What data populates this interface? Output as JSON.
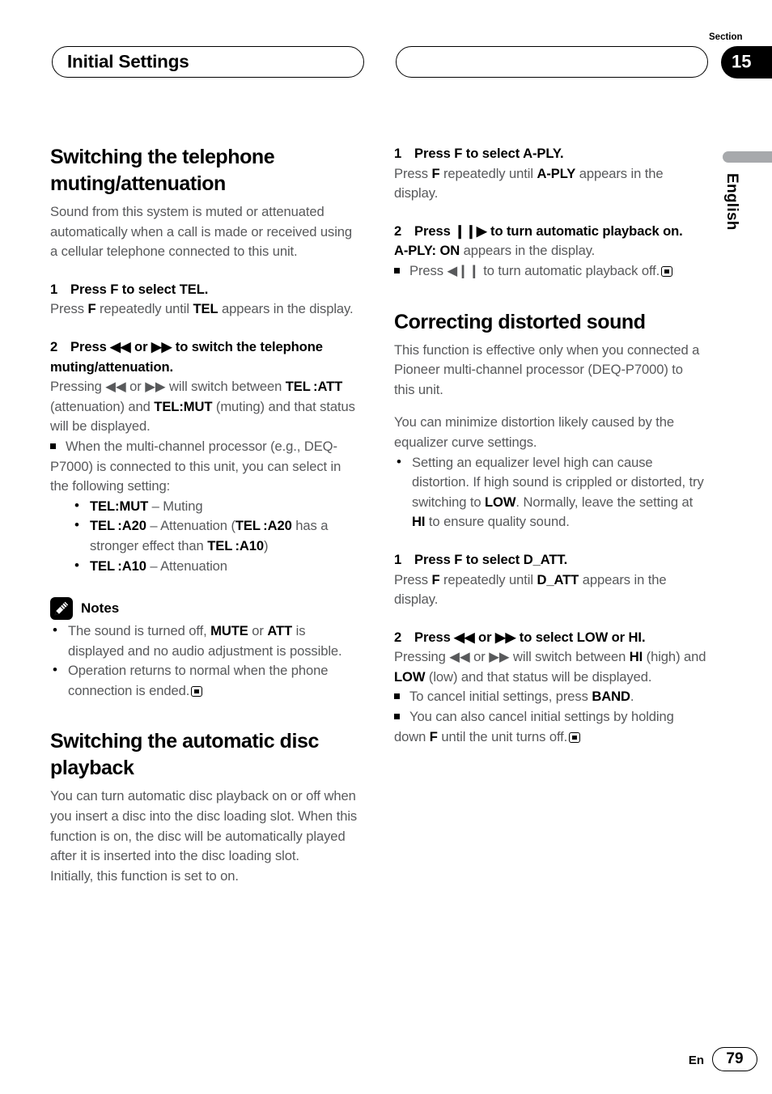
{
  "header": {
    "left_title": "Initial Settings",
    "right_title": "",
    "section_label": "Section",
    "section_number": "15"
  },
  "side_tab": {
    "language": "English"
  },
  "footer": {
    "lang_code": "En",
    "page_number": "79"
  },
  "icons": {
    "notes_icon": "pencil-icon",
    "end_of_section": "filled-square-in-box"
  },
  "colors": {
    "body_text": "#58595b",
    "heading_text": "#000000",
    "badge_bg": "#000000",
    "lang_bar": "#a7a9ac"
  },
  "left_column": {
    "heading1": "Switching the telephone muting/attenuation",
    "intro1": "Sound from this system is muted or attenuated automatically when a call is made or received using a cellular telephone connected to this unit.",
    "step1": {
      "number": "1",
      "title": "Press F to select TEL.",
      "body_pre": "Press ",
      "body_b1": "F",
      "body_mid": " repeatedly until ",
      "body_b2": "TEL",
      "body_post": " appears in the display."
    },
    "step2": {
      "number": "2",
      "title": "Press ◀◀ or ▶▶ to switch the telephone muting/attenuation.",
      "body_pre": "Pressing ",
      "body_sym1": "◀◀",
      "body_mid1": " or ",
      "body_sym2": "▶▶",
      "body_mid2": " will switch between ",
      "body_b1": "TEL :ATT",
      "body_mid3": " (attenuation) and ",
      "body_b2": "TEL:MUT",
      "body_post": " (muting) and that status will be displayed."
    },
    "note_square": "When the multi-channel processor (e.g., DEQ-P7000) is connected to this unit, you can select in the following setting:",
    "setting_bullets": [
      {
        "term": "TEL:MUT",
        "desc": " – Muting"
      },
      {
        "term": "TEL :A20",
        "desc_a": " – Attenuation (",
        "term2": "TEL :A20",
        "desc_b": " has a stronger effect than ",
        "term3": "TEL :A10",
        "desc_c": ")"
      },
      {
        "term": "TEL :A10",
        "desc": " – Attenuation"
      }
    ],
    "notes_title": "Notes",
    "notes": [
      {
        "pre": "The sound is turned off, ",
        "b1": "MUTE",
        "mid": " or ",
        "b2": "ATT",
        "post": " is displayed and no audio adjustment is possible."
      },
      {
        "pre": "Operation returns to normal when the phone connection is ended.",
        "b1": "",
        "mid": "",
        "b2": "",
        "post": ""
      }
    ],
    "heading2": "Switching the automatic disc playback",
    "intro2": "You can turn automatic disc playback on or off when you insert a disc into the disc loading slot. When this function is on, the disc will be automatically played after it is inserted into the disc loading slot.",
    "intro2b": "Initially, this function is set to on."
  },
  "right_column": {
    "step1": {
      "number": "1",
      "title": "Press F to select A-PLY.",
      "body_pre": "Press ",
      "body_b1": "F",
      "body_mid": " repeatedly until ",
      "body_b2": "A-PLY",
      "body_post": " appears in the display."
    },
    "step2": {
      "number": "2",
      "title_pre": "Press ",
      "title_sym": "❙❙▶",
      "title_post": " to turn automatic playback on.",
      "body_b1": "A-PLY: ON",
      "body_post": " appears in the display.",
      "note_pre": "Press ",
      "note_sym": "◀❙❙",
      "note_post": " to turn automatic playback off."
    },
    "heading1": "Correcting distorted sound",
    "intro1": "This function is effective only when you connected a Pioneer multi-channel processor (DEQ-P7000) to this unit.",
    "intro2": "You can minimize distortion likely caused by the equalizer curve settings.",
    "bullet1": {
      "pre": "Setting an equalizer level high can cause distortion. If high sound is crippled or distorted, try switching to ",
      "b1": "LOW",
      "mid": ". Normally, leave the setting at ",
      "b2": "HI",
      "post": " to ensure quality sound."
    },
    "step3": {
      "number": "1",
      "title": "Press F to select D_ATT.",
      "body_pre": "Press ",
      "body_b1": "F",
      "body_mid": " repeatedly until ",
      "body_b2": "D_ATT",
      "body_post": " appears in the display."
    },
    "step4": {
      "number": "2",
      "title": "Press ◀◀ or ▶▶ to select LOW or HI.",
      "body_pre": "Pressing ",
      "body_sym1": "◀◀",
      "body_mid1": " or ",
      "body_sym2": "▶▶",
      "body_mid2": " will switch between ",
      "body_b1": "HI",
      "body_mid3": " (high) and ",
      "body_b2": "LOW",
      "body_post": " (low) and that status will be displayed."
    },
    "note1": {
      "pre": "To cancel initial settings, press ",
      "b1": "BAND",
      "post": "."
    },
    "note2": {
      "pre": "You can also cancel initial settings by holding down ",
      "b1": "F",
      "post": " until the unit turns off."
    }
  }
}
